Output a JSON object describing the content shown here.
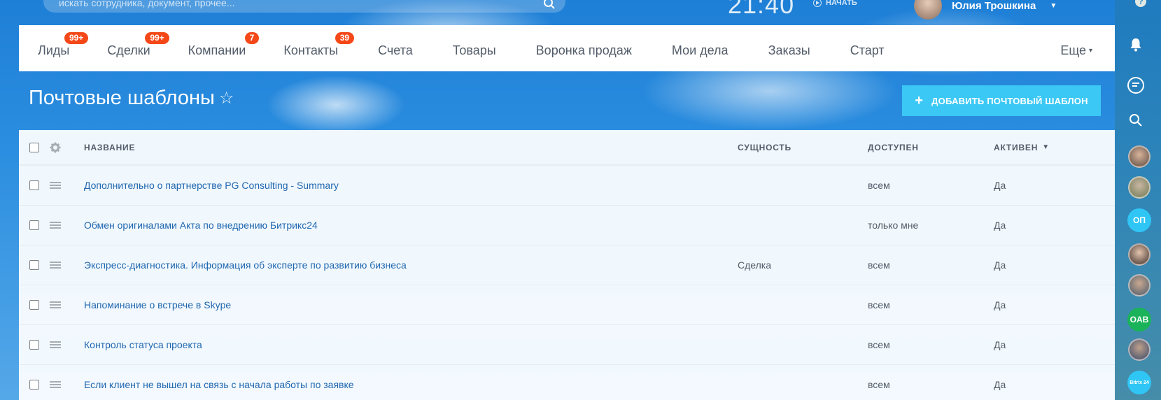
{
  "header": {
    "search_placeholder": "искать сотрудника, документ, прочее...",
    "clock": "21:40",
    "start_label": "НАЧАТЬ",
    "user_name": "Юлия Трошкина",
    "help": "?"
  },
  "nav": {
    "items": [
      {
        "label": "Лиды",
        "badge": "99+"
      },
      {
        "label": "Сделки",
        "badge": "99+"
      },
      {
        "label": "Компании",
        "badge": "7"
      },
      {
        "label": "Контакты",
        "badge": "39"
      },
      {
        "label": "Счета"
      },
      {
        "label": "Товары"
      },
      {
        "label": "Воронка продаж"
      },
      {
        "label": "Мои дела"
      },
      {
        "label": "Заказы"
      },
      {
        "label": "Старт"
      }
    ],
    "more_label": "Еще"
  },
  "page": {
    "title": "Почтовые шаблоны",
    "add_button": "ДОБАВИТЬ ПОЧТОВЫЙ ШАБЛОН"
  },
  "grid": {
    "columns": {
      "name": "НАЗВАНИЕ",
      "entity": "СУЩНОСТЬ",
      "available": "ДОСТУПЕН",
      "active": "АКТИВЕН"
    },
    "rows": [
      {
        "name": "Дополнительно о партнерстве PG Consulting - Summary",
        "entity": "",
        "available": "всем",
        "active": "Да"
      },
      {
        "name": "Обмен оригиналами Акта по внедрению Битрикс24",
        "entity": "",
        "available": "только мне",
        "active": "Да"
      },
      {
        "name": "Экспресс-диагностика. Информация об эксперте по развитию бизнеса",
        "entity": "Сделка",
        "available": "всем",
        "active": "Да"
      },
      {
        "name": "Напоминание о встрече в Skype",
        "entity": "",
        "available": "всем",
        "active": "Да"
      },
      {
        "name": "Контроль статуса проекта",
        "entity": "",
        "available": "всем",
        "active": "Да"
      },
      {
        "name": "Если клиент не вышел на связь с начала работы по заявке",
        "entity": "",
        "available": "всем",
        "active": "Да"
      }
    ]
  },
  "sidebar": {
    "initials_1": "ОП",
    "initials_2": "OAB",
    "b24_label": "Bitrix 24"
  },
  "colors": {
    "accent": "#3bc8f5",
    "badge": "#f54819",
    "link": "#2067b0"
  }
}
